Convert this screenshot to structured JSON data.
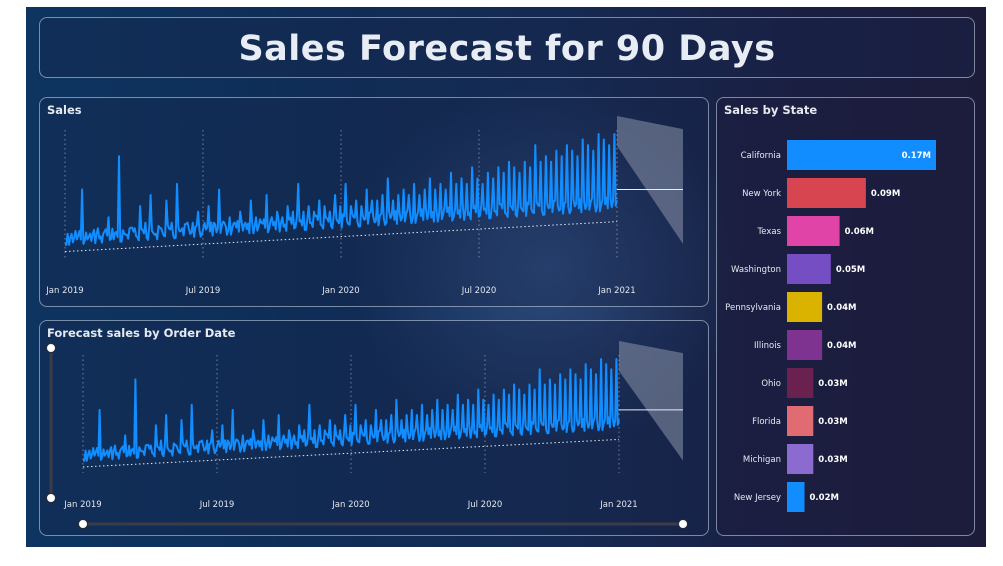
{
  "page": {
    "title": "Sales Forecast for 90 Days"
  },
  "colors": {
    "series": "#118dff",
    "trend": "#ffffff",
    "forecast_band": "#8b94a8",
    "grid": "#a8b4c8"
  },
  "sales_chart": {
    "title": "Sales"
  },
  "forecast_chart": {
    "title": "Forecast sales by Order Date",
    "slider": {
      "start_fraction": 0.0,
      "end_fraction": 1.0
    }
  },
  "state_chart": {
    "title": "Sales by State"
  },
  "chart_data": [
    {
      "type": "line",
      "title": "Sales",
      "x_ticks": [
        "Jan 2019",
        "Jul 2019",
        "Jan 2020",
        "Jul 2020",
        "Jan 2021"
      ],
      "x_range": [
        "2019-01-01",
        "2021-03-31"
      ],
      "gridlines": true,
      "series": [
        {
          "values_weekly": [
            2,
            4,
            3,
            12,
            3,
            4,
            5,
            4,
            7,
            3,
            18,
            4,
            5,
            5,
            9,
            6,
            11,
            4,
            5,
            10,
            6,
            13,
            5,
            6,
            6,
            8,
            5,
            9,
            6,
            12,
            6,
            7,
            6,
            8,
            6,
            10,
            7,
            6,
            11,
            7,
            8,
            7,
            9,
            8,
            13,
            8,
            9,
            8,
            10,
            9,
            8,
            11,
            9,
            13,
            9,
            10,
            9,
            12,
            10,
            10,
            11,
            14,
            10,
            11,
            12,
            11,
            13,
            11,
            12,
            14,
            12,
            13,
            12,
            15,
            13,
            14,
            13,
            16,
            14,
            13,
            15,
            14,
            16,
            15,
            17,
            16,
            15,
            17,
            16,
            20,
            17,
            18,
            17,
            19,
            18,
            20,
            19,
            18,
            21,
            20,
            19,
            22,
            21,
            20,
            22
          ],
          "forecast_mid": 12,
          "forecast_upper": 20,
          "forecast_lower": 4
        }
      ]
    },
    {
      "type": "line",
      "title": "Forecast sales by Order Date",
      "x_ticks": [
        "Jan 2019",
        "Jul 2019",
        "Jan 2020",
        "Jul 2020",
        "Jan 2021"
      ],
      "x_range": [
        "2019-01-01",
        "2021-03-31"
      ],
      "gridlines": true,
      "series": [
        {
          "values_weekly": [
            2,
            4,
            3,
            12,
            3,
            4,
            5,
            4,
            7,
            3,
            18,
            4,
            5,
            5,
            9,
            6,
            11,
            4,
            5,
            10,
            6,
            13,
            5,
            6,
            6,
            8,
            5,
            9,
            6,
            12,
            6,
            7,
            6,
            8,
            6,
            10,
            7,
            6,
            11,
            7,
            8,
            7,
            9,
            8,
            13,
            8,
            9,
            8,
            10,
            9,
            8,
            11,
            9,
            13,
            9,
            10,
            9,
            12,
            10,
            10,
            11,
            14,
            10,
            11,
            12,
            11,
            13,
            11,
            12,
            14,
            12,
            13,
            12,
            15,
            13,
            14,
            13,
            16,
            14,
            13,
            15,
            14,
            16,
            15,
            17,
            16,
            15,
            17,
            16,
            20,
            17,
            18,
            17,
            19,
            18,
            20,
            19,
            18,
            21,
            20,
            19,
            22,
            21,
            20,
            22
          ],
          "forecast_mid": 12,
          "forecast_upper": 20,
          "forecast_lower": 4
        }
      ]
    },
    {
      "type": "bar",
      "orientation": "horizontal",
      "title": "Sales by State",
      "categories": [
        "California",
        "New York",
        "Texas",
        "Washington",
        "Pennsylvania",
        "Illinois",
        "Ohio",
        "Florida",
        "Michigan",
        "New Jersey"
      ],
      "values": [
        0.17,
        0.09,
        0.06,
        0.05,
        0.04,
        0.04,
        0.03,
        0.03,
        0.03,
        0.02
      ],
      "value_labels": [
        "0.17M",
        "0.09M",
        "0.06M",
        "0.05M",
        "0.04M",
        "0.04M",
        "0.03M",
        "0.03M",
        "0.03M",
        "0.02M"
      ],
      "colors": [
        "#118dff",
        "#d64550",
        "#e044a7",
        "#744ec2",
        "#d9b300",
        "#7f3390",
        "#6b2150",
        "#e06b73",
        "#8b6bd0",
        "#118dff"
      ],
      "xlim": [
        0,
        0.17
      ]
    }
  ]
}
